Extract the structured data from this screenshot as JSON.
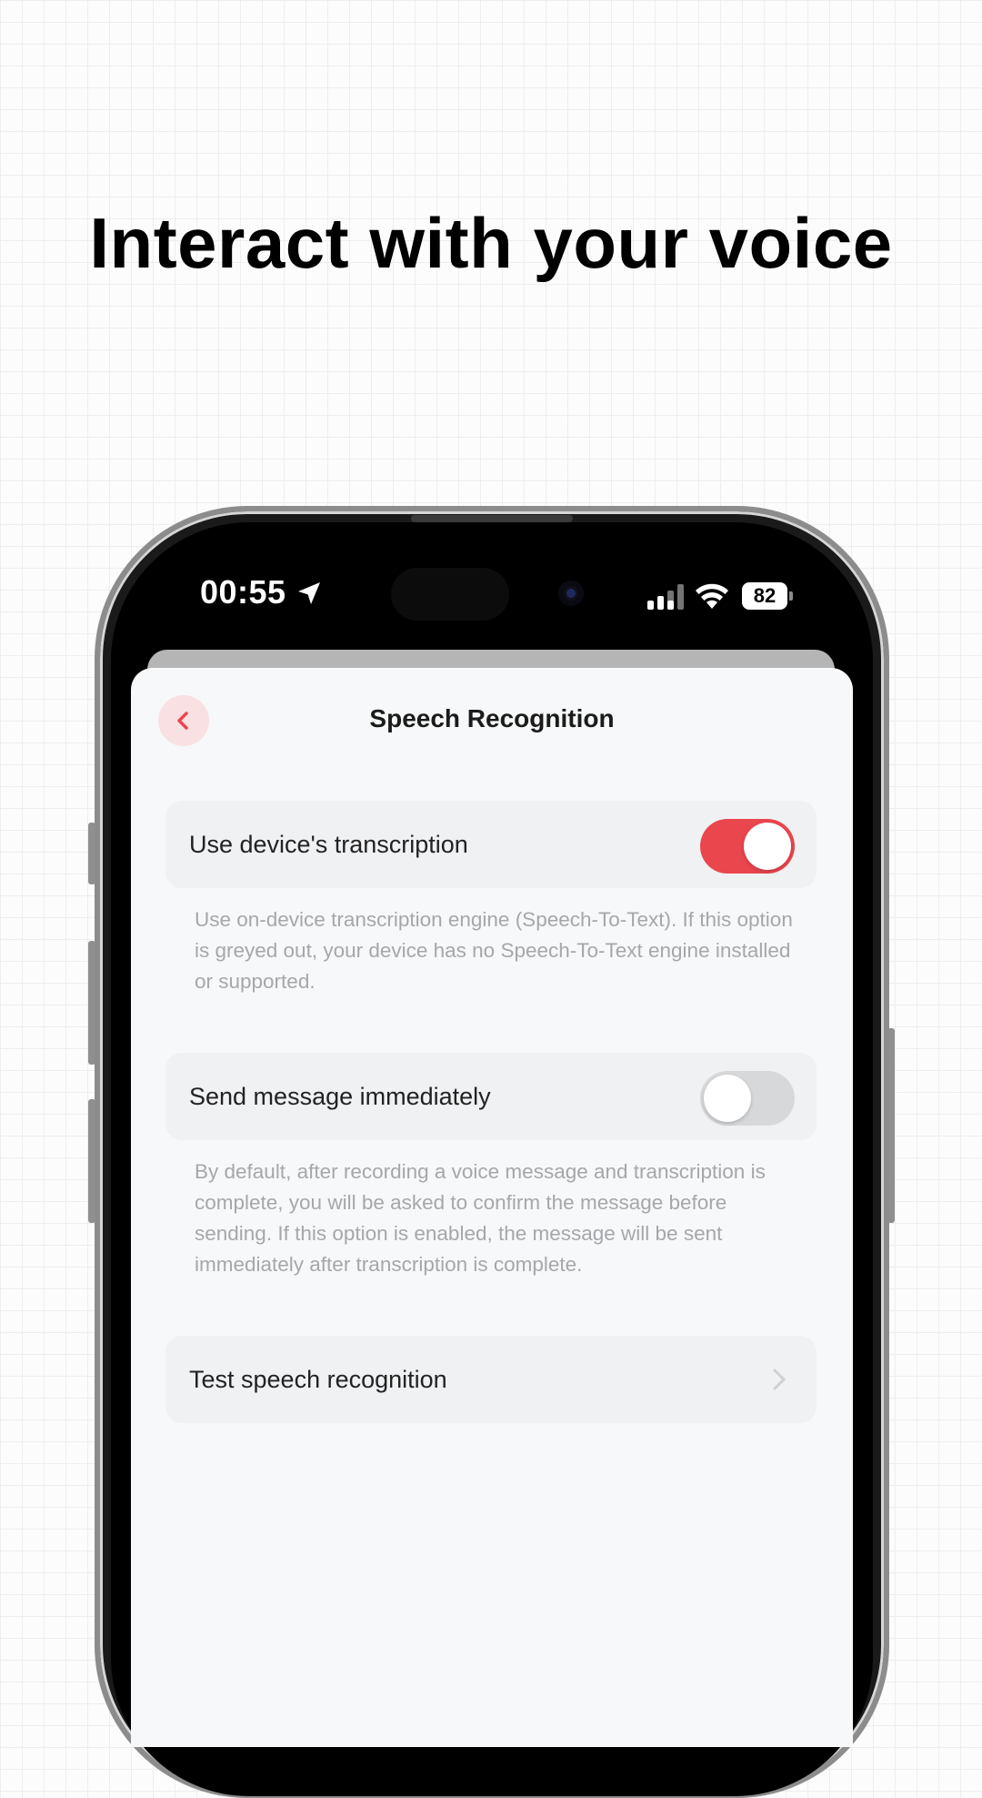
{
  "headline": "Interact with your voice",
  "status_bar": {
    "time": "00:55",
    "battery": "82",
    "icons": [
      "location-arrow-icon",
      "signal-icon",
      "wifi-icon",
      "battery-icon"
    ]
  },
  "screen": {
    "title": "Speech Recognition",
    "back_icon": "chevron-left-icon",
    "settings": [
      {
        "label": "Use device's transcription",
        "enabled": true,
        "description": "Use on-device transcription engine (Speech-To-Text). If this option is greyed out, your device has no Speech-To-Text engine installed or supported."
      },
      {
        "label": "Send message immediately",
        "enabled": false,
        "description": "By default, after recording a voice message and transcription is complete, you will be asked to confirm the message before sending. If this option is enabled, the message will be sent immediately after transcription is complete."
      }
    ],
    "test_row": {
      "label": "Test speech recognition",
      "icon": "chevron-right-icon"
    }
  },
  "colors": {
    "accent": "#ea464d",
    "accent_soft": "#f9e1e3",
    "toggle_off": "#d7d8da",
    "row_bg": "#f0f1f3",
    "screen_bg": "#f7f8f9",
    "description_text": "#a5a7ab"
  }
}
